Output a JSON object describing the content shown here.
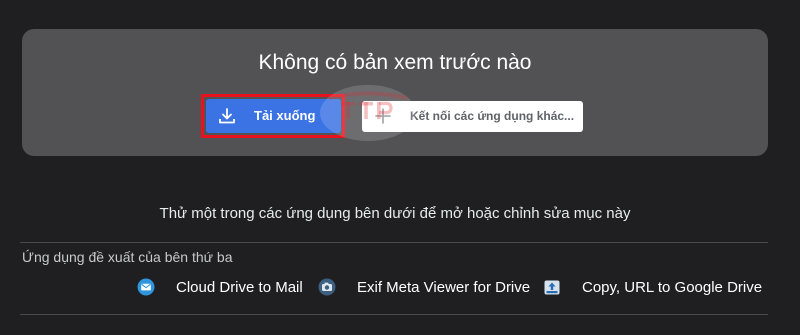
{
  "preview": {
    "title": "Không có bản xem trước nào",
    "download_label": "Tải xuống",
    "connect_label": "Kết nối các ứng dụng khác..."
  },
  "hint": "Thử một trong các ứng dụng bên dưới để mở hoặc chỉnh sửa mục này",
  "suggested": {
    "label": "Ứng dụng đề xuất của bên thứ ba",
    "apps": [
      {
        "label": "Cloud Drive to Mail",
        "icon": "mail-icon"
      },
      {
        "label": "Exif Meta Viewer for Drive",
        "icon": "camera-icon"
      },
      {
        "label": "Copy, URL to Google Drive",
        "icon": "upload-icon"
      }
    ]
  },
  "colors": {
    "background": "#1f1f21",
    "panel": "#525254",
    "primary_button": "#3b72e4",
    "highlight": "#e8121f"
  }
}
